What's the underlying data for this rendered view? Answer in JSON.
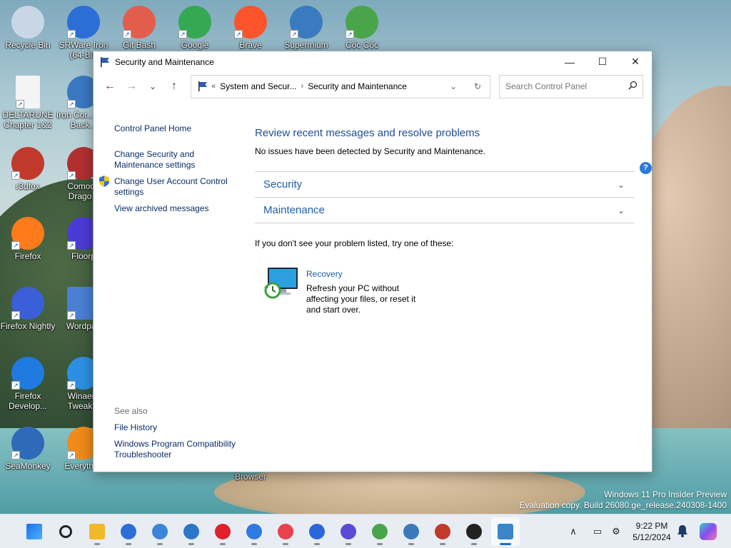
{
  "desktop": {
    "icons": [
      {
        "label": "Recycle Bin",
        "color": "#c9d6e6"
      },
      {
        "label": "SRWare Iron (64-Bit)",
        "color": "#2b6fd6"
      },
      {
        "label": "Git Bash",
        "color": "#e35d4c"
      },
      {
        "label": "Google",
        "color": "#34a853"
      },
      {
        "label": "Brave",
        "color": "#fb542b"
      },
      {
        "label": "Supermium",
        "color": "#3a7bbf"
      },
      {
        "label": "Cốc Cốc",
        "color": "#4aa54a"
      },
      {
        "label": "DELTARUNE Chapter 1&2",
        "color": "#f4f4f4"
      },
      {
        "label": "Iron Cor... and Back...",
        "color": "#3a78c2"
      },
      {
        "label": "r3dfox",
        "color": "#c0392b"
      },
      {
        "label": "Comodo Drago...",
        "color": "#b03030"
      },
      {
        "label": "Firefox",
        "color": "#ff7a1a"
      },
      {
        "label": "Floorp",
        "color": "#4b3bd6"
      },
      {
        "label": "Firefox Nightly",
        "color": "#3b5fd6"
      },
      {
        "label": "Wordpad",
        "color": "#4a7fd4"
      },
      {
        "label": "Firefox Develop...",
        "color": "#1f7be0"
      },
      {
        "label": "Winaero Tweak...",
        "color": "#2d8fe3"
      },
      {
        "label": "SeaMonkey",
        "color": "#2f6ab8"
      },
      {
        "label": "Everythi...",
        "color": "#f08a1a"
      },
      {
        "label": "Browser",
        "color": "#3a7bbf"
      }
    ],
    "watermark_line1": "Windows 11 Pro Insider Preview",
    "watermark_line2": "Evaluation copy. Build 26080.ge_release.240308-1400"
  },
  "window": {
    "title": "Security and Maintenance",
    "title_icon": "flag-icon",
    "controls": {
      "minimize": "—",
      "maximize": "☐",
      "close": "✕"
    }
  },
  "navbar": {
    "back": "←",
    "forward": "→",
    "recent": "⌄",
    "up": "↑",
    "address": {
      "prefix": "«",
      "crumb1": "System and Secur...",
      "separator": "›",
      "crumb2": "Security and Maintenance",
      "dropdown": "⌄",
      "refresh": "↻"
    },
    "search_placeholder": "Search Control Panel",
    "search_icon": "search-icon"
  },
  "left_pane": {
    "home": "Control Panel Home",
    "link1": "Change Security and Maintenance settings",
    "link2": "Change User Account Control settings",
    "link3": "View archived messages",
    "see_also": "See also",
    "see1": "File History",
    "see2": "Windows Program Compatibility Troubleshooter"
  },
  "main": {
    "help": "?",
    "title": "Review recent messages and resolve problems",
    "subtitle": "No issues have been detected by Security and Maintenance.",
    "sections": [
      {
        "label": "Security",
        "chevron": "⌄"
      },
      {
        "label": "Maintenance",
        "chevron": "⌄"
      }
    ],
    "try_text": "If you don't see your problem listed, try one of these:",
    "recovery": {
      "title": "Recovery",
      "description": "Refresh your PC without affecting your files, or reset it and start over."
    }
  },
  "taskbar": {
    "apps": [
      {
        "name": "start",
        "color": "#1a73e8",
        "active": false
      },
      {
        "name": "search",
        "color": "#222222",
        "active": false
      },
      {
        "name": "file-explorer",
        "color": "#f2b82c",
        "active": false
      },
      {
        "name": "srware-iron",
        "color": "#2b6fd6",
        "active": false
      },
      {
        "name": "supermium",
        "color": "#3a86d8",
        "active": false
      },
      {
        "name": "browser-store",
        "color": "#2a77c9",
        "active": false
      },
      {
        "name": "opera",
        "color": "#e0202a",
        "active": false
      },
      {
        "name": "browser-blue",
        "color": "#2e7ae0",
        "active": false
      },
      {
        "name": "opera-gx",
        "color": "#e8424d",
        "active": false
      },
      {
        "name": "firefox",
        "color": "#2b66d9",
        "active": false
      },
      {
        "name": "firefox-nightly",
        "color": "#5a4bd6",
        "active": false
      },
      {
        "name": "coc-coc",
        "color": "#4aa54a",
        "active": false
      },
      {
        "name": "globe-browser",
        "color": "#3a7ab8",
        "active": false
      },
      {
        "name": "r3dfox",
        "color": "#c0392b",
        "active": false
      },
      {
        "name": "mask-app",
        "color": "#222222",
        "active": false
      },
      {
        "name": "control-panel",
        "color": "#3a86c8",
        "active": true
      }
    ],
    "tray": {
      "chevron": "∧",
      "monitor": "▭",
      "settings": "⚙"
    },
    "time": "9:22 PM",
    "date": "5/12/2024"
  }
}
